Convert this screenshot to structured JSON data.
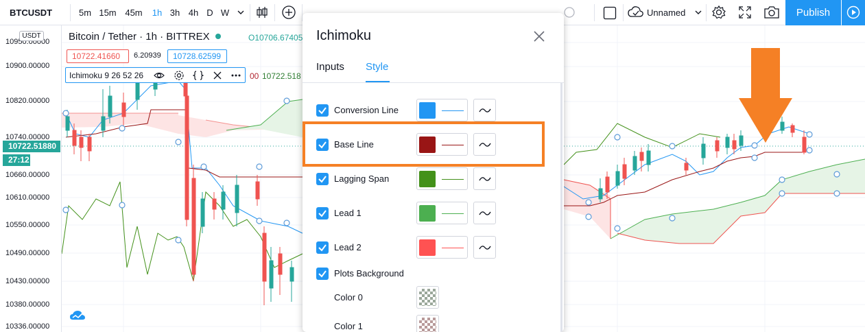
{
  "toolbar": {
    "symbol": "BTCUSDT",
    "intervals": [
      "5m",
      "15m",
      "45m",
      "1h",
      "3h",
      "4h",
      "D",
      "W"
    ],
    "active_interval": "1h",
    "layout_name": "Unnamed",
    "publish_label": "Publish"
  },
  "price_axis": {
    "currency": "USDT",
    "labels": [
      "10950.00000",
      "10900.00000",
      "10820.00000",
      "10740.00000",
      "10660.00000",
      "10610.00000",
      "10550.00000",
      "10490.00000",
      "10430.00000",
      "10380.00000",
      "10336.00000"
    ],
    "last_price": "10722.51880",
    "countdown": "27:12"
  },
  "legend": {
    "title": "Bitcoin / Tether · 1h · BITTREX",
    "open_value": "O10706.67405",
    "bid": "10722.41660",
    "spread": "6.20939",
    "ask": "10728.62599",
    "study_label": "Ichimoku 9 26 52 26",
    "study_value_red": "00",
    "study_value_green": "10722.518"
  },
  "dialog": {
    "title": "Ichimoku",
    "tabs": [
      {
        "label": "Inputs",
        "active": false
      },
      {
        "label": "Style",
        "active": true
      }
    ],
    "plots": [
      {
        "label": "Conversion Line",
        "checked": true,
        "color": "#2196f3"
      },
      {
        "label": "Base Line",
        "checked": true,
        "color": "#991515"
      },
      {
        "label": "Lagging Span",
        "checked": true,
        "color": "#43911a"
      },
      {
        "label": "Lead 1",
        "checked": true,
        "color": "#4caf50"
      },
      {
        "label": "Lead 2",
        "checked": true,
        "color": "#ff5252"
      }
    ],
    "plots_background": {
      "label": "Plots Background",
      "checked": true
    },
    "background_colors": [
      {
        "label": "Color 0"
      },
      {
        "label": "Color 1"
      }
    ]
  },
  "colors": {
    "accent": "#2196f3",
    "up": "#26a69a",
    "down": "#ef5350",
    "annotation": "#f58025"
  }
}
